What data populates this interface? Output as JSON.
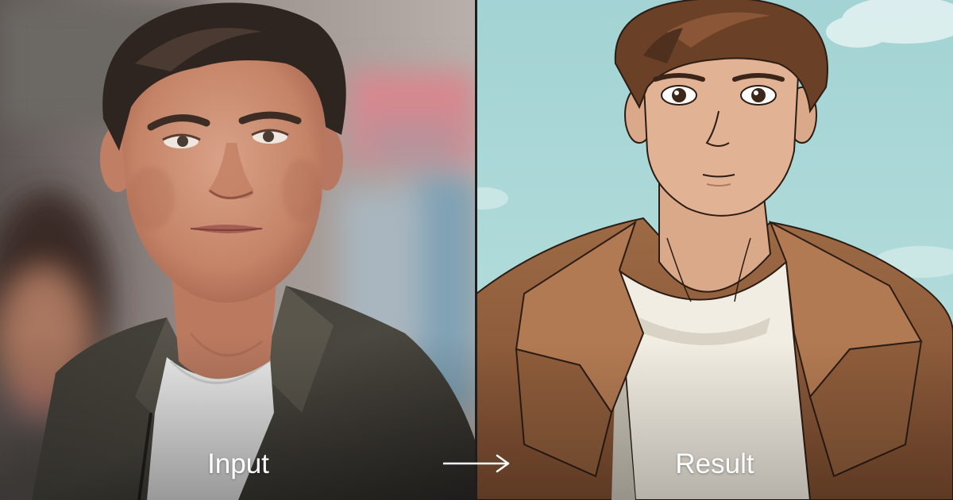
{
  "labels": {
    "input": "Input",
    "result": "Result"
  },
  "icons": {
    "arrow": "right-arrow-icon"
  },
  "colors": {
    "caption_text": "#ffffff",
    "sky": "#a9d7d6",
    "jacket_left": "#44413a",
    "jacket_right": "#8f5d3b",
    "shirt": "#f1eee5",
    "hair": "#6a4027"
  }
}
